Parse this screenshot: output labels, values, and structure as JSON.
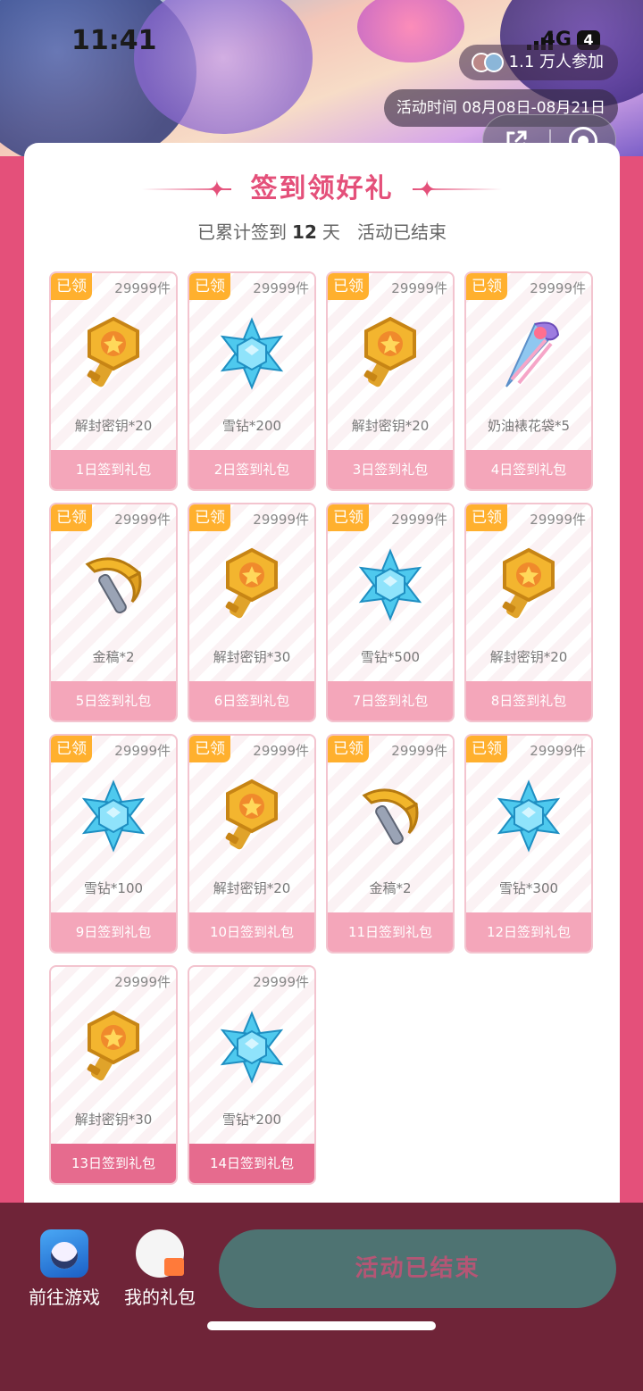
{
  "status": {
    "time": "11:41",
    "network": "4G",
    "battery": "4"
  },
  "header": {
    "participants": "1.1 万人参加",
    "period": "活动时间 08月08日-08月21日"
  },
  "card": {
    "title": "签到领好礼",
    "subtitle_prefix": "已累计签到",
    "days": "12",
    "subtitle_unit": "天",
    "subtitle_status": "活动已结束"
  },
  "gifts": [
    {
      "claimed": "已领",
      "stock": "29999件",
      "name": "解封密钥*20",
      "day": "1日签到礼包",
      "icon": "key"
    },
    {
      "claimed": "已领",
      "stock": "29999件",
      "name": "雪钻*200",
      "day": "2日签到礼包",
      "icon": "gem"
    },
    {
      "claimed": "已领",
      "stock": "29999件",
      "name": "解封密钥*20",
      "day": "3日签到礼包",
      "icon": "key"
    },
    {
      "claimed": "已领",
      "stock": "29999件",
      "name": "奶油裱花袋*5",
      "day": "4日签到礼包",
      "icon": "piping-bag"
    },
    {
      "claimed": "已领",
      "stock": "29999件",
      "name": "金稿*2",
      "day": "5日签到礼包",
      "icon": "pickaxe"
    },
    {
      "claimed": "已领",
      "stock": "29999件",
      "name": "解封密钥*30",
      "day": "6日签到礼包",
      "icon": "key"
    },
    {
      "claimed": "已领",
      "stock": "29999件",
      "name": "雪钻*500",
      "day": "7日签到礼包",
      "icon": "gem"
    },
    {
      "claimed": "已领",
      "stock": "29999件",
      "name": "解封密钥*20",
      "day": "8日签到礼包",
      "icon": "key"
    },
    {
      "claimed": "已领",
      "stock": "29999件",
      "name": "雪钻*100",
      "day": "9日签到礼包",
      "icon": "gem"
    },
    {
      "claimed": "已领",
      "stock": "29999件",
      "name": "解封密钥*20",
      "day": "10日签到礼包",
      "icon": "key"
    },
    {
      "claimed": "已领",
      "stock": "29999件",
      "name": "金稿*2",
      "day": "11日签到礼包",
      "icon": "pickaxe"
    },
    {
      "claimed": "已领",
      "stock": "29999件",
      "name": "雪钻*300",
      "day": "12日签到礼包",
      "icon": "gem"
    },
    {
      "claimed": "",
      "stock": "29999件",
      "name": "解封密钥*30",
      "day": "13日签到礼包",
      "icon": "key"
    },
    {
      "claimed": "",
      "stock": "29999件",
      "name": "雪钻*200",
      "day": "14日签到礼包",
      "icon": "gem"
    }
  ],
  "bottom": {
    "go_game": "前往游戏",
    "my_gifts": "我的礼包",
    "end_button": "活动已结束"
  },
  "colors": {
    "accent": "#e4507a",
    "claimed_badge": "#ffb02e",
    "bottom_bg": "#6f2438",
    "end_button": "#4e7372"
  }
}
